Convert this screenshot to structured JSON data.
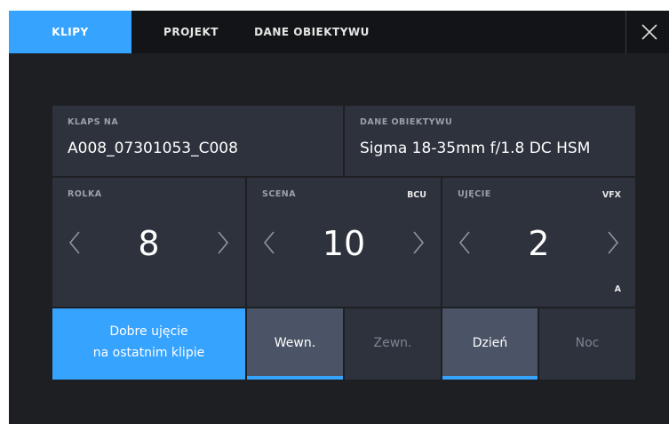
{
  "tabs": [
    "KLIPY",
    "PROJEKT",
    "DANE OBIEKTYWU"
  ],
  "klaps": {
    "label": "KLAPS NA",
    "value": "A008_07301053_C008"
  },
  "dane": {
    "label": "DANE OBIEKTYWU",
    "value": "Sigma 18-35mm f/1.8 DC HSM"
  },
  "rolka": {
    "label": "ROLKA",
    "value": "8"
  },
  "scena": {
    "label": "SCENA",
    "tag": "BCU",
    "value": "10"
  },
  "ujecie": {
    "label": "UJĘCIE",
    "tag": "VFX",
    "value": "2",
    "sub": "A"
  },
  "good_take": {
    "line1": "Dobre ujęcie",
    "line2": "na ostatnim klipie"
  },
  "location": {
    "interior": "Wewn.",
    "exterior": "Zewn.",
    "selected": "interior"
  },
  "time_of_day": {
    "day": "Dzień",
    "night": "Noc",
    "selected": "day"
  },
  "colors": {
    "accent": "#36a3ff",
    "panel": "#2d323c",
    "background": "#1e1f23",
    "tabbar": "#131417",
    "selected_toggle": "#4b5466"
  }
}
